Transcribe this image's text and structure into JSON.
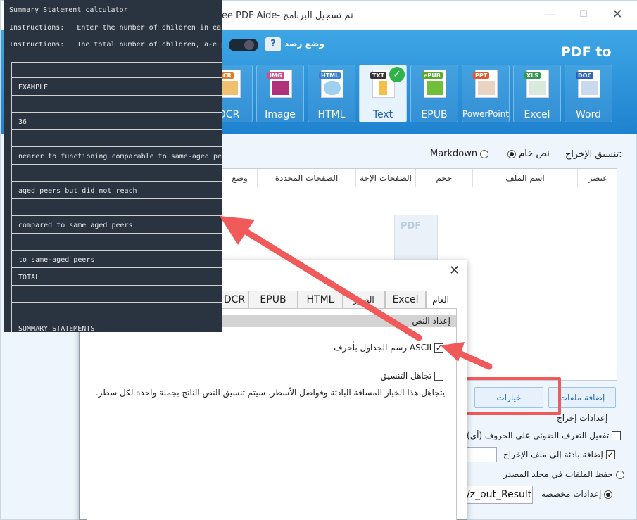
{
  "app": {
    "title": "تم تسجيل البرنامج- Free PDF Aide",
    "title_visible": "ee PDF Aide- تم تسجيل البرنامج",
    "monitor_label": "وضع رصد",
    "help_label": "?",
    "pdf_to": "PDF to",
    "formats": [
      {
        "badge": "OCR",
        "label": "OCR",
        "color": "#e07b28"
      },
      {
        "badge": "IMG",
        "label": "Image",
        "color": "#d64a8a"
      },
      {
        "badge": "HTML",
        "label": "HTML",
        "color": "#3b7fd1"
      },
      {
        "badge": "TXT",
        "label": "Text",
        "color": "#333333"
      },
      {
        "badge": "ePUB",
        "label": "EPUB",
        "color": "#5aa82d"
      },
      {
        "badge": "PPT",
        "label": "PowerPoint",
        "color": "#e2572c"
      },
      {
        "badge": "XLS",
        "label": "Excel",
        "color": "#2f9a4e"
      },
      {
        "badge": "DOC",
        "label": "Word",
        "color": "#2b63b6"
      }
    ],
    "output_format_label": "تنسيق الإخراج:",
    "output_plain": "نص خام",
    "output_markdown": "Markdown",
    "columns": [
      "عنصر",
      "اسم الملف",
      "حجم",
      "الصفحات الإجه",
      "الصفحات المحددة",
      "وضع"
    ],
    "watermark": "PDF",
    "add_files_label": "إضافة ملفات",
    "options_label": "خيارات",
    "output_settings_label": "إعدادات إخراج",
    "ocr_label": "(تفعيل التعرف الضوئي على الحروف (أي",
    "prefix_label": "إضافة بادئة إلى ملف الإخراج",
    "save_source_label": "حفظ الملفات في مجلد المصدر",
    "custom_label": "إعدادات مخصصة",
    "custom_path": "/z_out_Result"
  },
  "dialog": {
    "close_label": "✕",
    "tabs": [
      "DCR",
      "EPUB",
      "HTML",
      "الصور",
      "Excel",
      "العام"
    ],
    "section": "إعداد النص",
    "ascii_label": "ASCII رسم الجداول بأحرف",
    "ignore_label": "تجاهل التنسيق",
    "ignore_desc": "يتجاهل هذا الخيار المسافة البادئة وفواصل الأسطر. سيتم تنسيق النص الناتج بجملة واحدة لكل سطر."
  },
  "terminal": {
    "lines": [
      "Summary Statement calculator",
      "Instructions:   Enter the number of children in each c",
      "Instructions:   The total number of children, a-e perc"
    ],
    "rows": [
      "EXAMPLE",
      "36",
      "nearer to functioning comparable to same-aged peers",
      "aged peers but did not reach",
      "compared to same aged peers",
      "to same-aged peers",
      "TOTAL",
      "SUMMARY STATEMENTS"
    ]
  }
}
